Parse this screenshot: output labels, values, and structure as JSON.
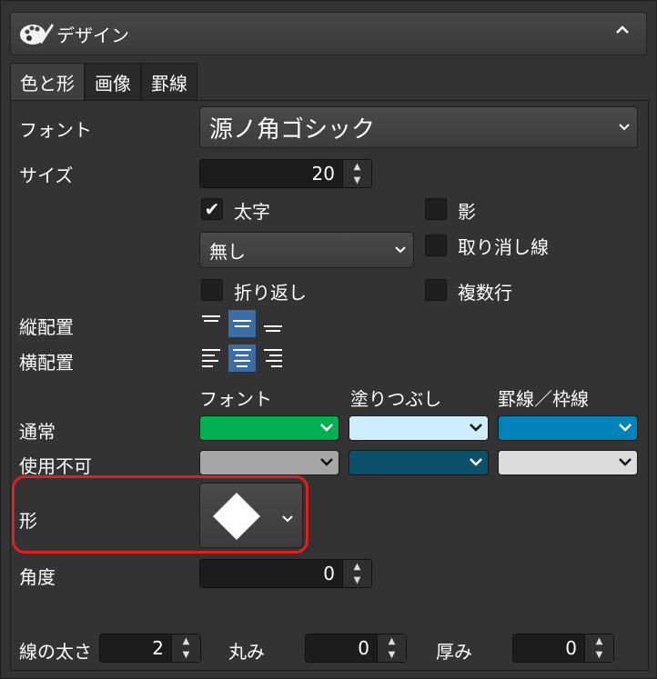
{
  "header": {
    "title": "デザイン",
    "icon": "palette-icon",
    "collapse_icon": "chevron-up-icon"
  },
  "tabs": [
    {
      "label": "色と形",
      "active": true
    },
    {
      "label": "画像",
      "active": false
    },
    {
      "label": "罫線",
      "active": false
    }
  ],
  "font": {
    "label": "フォント",
    "value": "源ノ角ゴシック"
  },
  "size": {
    "label": "サイズ",
    "value": "20"
  },
  "checkboxes": {
    "bold": {
      "label": "太字",
      "checked": true
    },
    "shadow": {
      "label": "影",
      "checked": false
    },
    "strikethrough": {
      "label": "取り消し線",
      "checked": false
    },
    "wrap": {
      "label": "折り返し",
      "checked": false
    },
    "multiline": {
      "label": "複数行",
      "checked": false
    }
  },
  "underline": {
    "value": "無し"
  },
  "vertical_align": {
    "label": "縦配置",
    "selected": "middle"
  },
  "horizontal_align": {
    "label": "横配置",
    "selected": "center"
  },
  "color_headers": {
    "font": "フォント",
    "fill": "塗りつぶし",
    "border": "罫線／枠線"
  },
  "normal": {
    "label": "通常",
    "font_color": "#00b050",
    "fill_color": "#cdeefc",
    "border_color": "#0083b8"
  },
  "disabled": {
    "label": "使用不可",
    "font_color": "#a6a6a6",
    "fill_color": "#0c516b",
    "border_color": "#dcdcdc"
  },
  "shape": {
    "label": "形",
    "value_icon": "diamond-icon"
  },
  "angle": {
    "label": "角度",
    "value": "0"
  },
  "line_width": {
    "label": "線の太さ",
    "value": "2"
  },
  "roundness": {
    "label": "丸み",
    "value": "0"
  },
  "thickness": {
    "label": "厚み",
    "value": "0"
  }
}
